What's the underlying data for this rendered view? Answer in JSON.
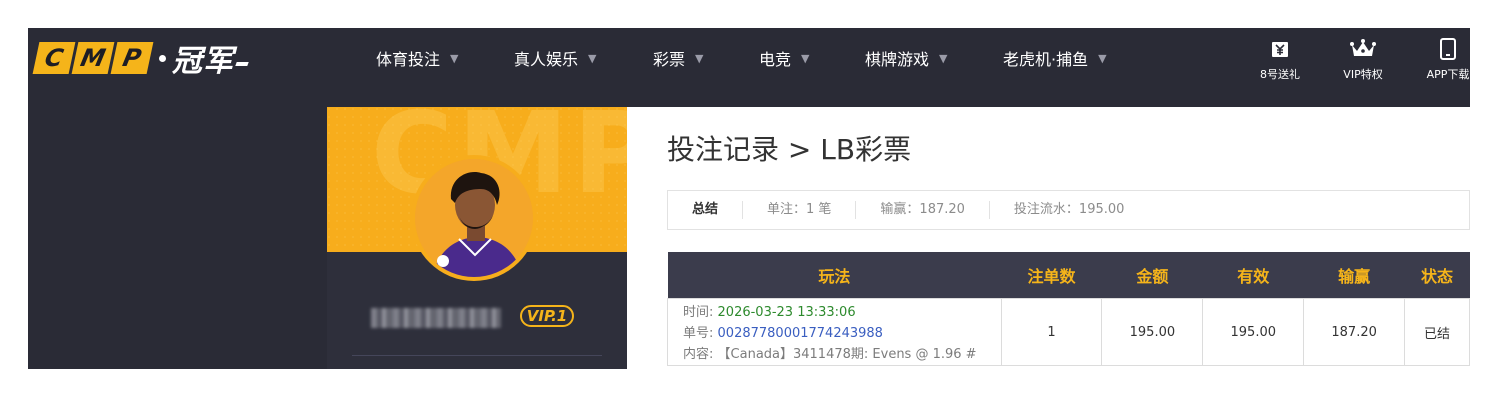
{
  "logo": {
    "letters": [
      "C",
      "M",
      "P"
    ],
    "cn": "冠军"
  },
  "nav": [
    {
      "label": "体育投注"
    },
    {
      "label": "真人娱乐"
    },
    {
      "label": "彩票"
    },
    {
      "label": "电竞"
    },
    {
      "label": "棋牌游戏"
    },
    {
      "label": "老虎机·捕鱼"
    }
  ],
  "right_nav": [
    {
      "label": "8号送礼",
      "icon": "yen-gift-icon"
    },
    {
      "label": "VIP特权",
      "icon": "crown-icon"
    },
    {
      "label": "APP下载",
      "icon": "phone-icon"
    }
  ],
  "profile": {
    "banner_watermark": "CMP",
    "vip_label": "VIP.1"
  },
  "page": {
    "title": "投注记录 > LB彩票"
  },
  "summary": {
    "label": "总结",
    "bets": "单注：1 笔",
    "winloss": "输赢：187.20",
    "turnover": "投注流水：195.00"
  },
  "table": {
    "headers": [
      "玩法",
      "注单数",
      "金额",
      "有效",
      "输赢",
      "状态"
    ],
    "rows": [
      {
        "time_label": "时间:",
        "time": "2026-03-23 13:33:06",
        "order_label": "单号:",
        "order": "00287780001774243988",
        "content_label": "内容:",
        "content": "【Canada】3411478期: Evens @ 1.96 #",
        "count": "1",
        "amount": "195.00",
        "valid": "195.00",
        "winloss": "187.20",
        "status": "已结"
      }
    ]
  },
  "colors": {
    "accent": "#f5b41a",
    "nav_bg": "#2a2b36",
    "header_bg": "#3b3c4c",
    "win": "#2d8a2d",
    "link": "#3a5ec0"
  }
}
